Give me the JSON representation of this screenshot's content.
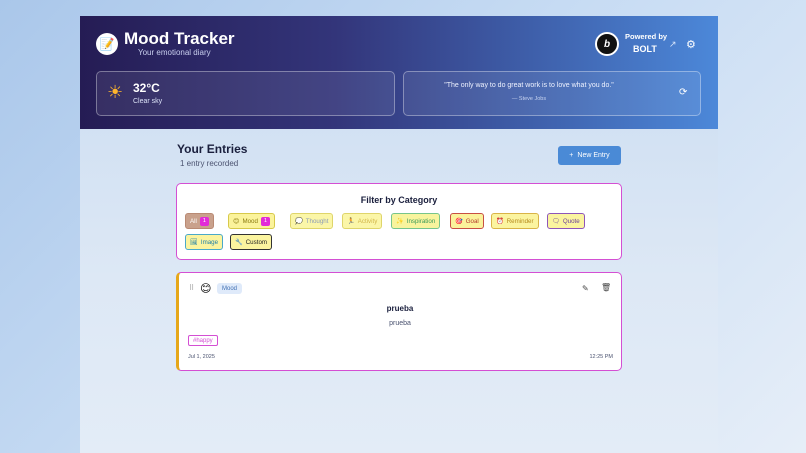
{
  "header": {
    "logo_icon": "📝",
    "title": "Mood Tracker",
    "subtitle": "Your emotional diary",
    "bolt_badge": "b",
    "powered_by": "Powered by",
    "bolt_name": "BOLT",
    "external_link_icon": "↗",
    "settings_icon": "⚙"
  },
  "weather": {
    "icon": "☀",
    "temperature": "32°C",
    "description": "Clear sky"
  },
  "quote": {
    "text": "\"The only way to do great work is to love what you do.\"",
    "author": "— Steve Jobs",
    "refresh_icon": "⟳"
  },
  "entries": {
    "title": "Your Entries",
    "count_label": "1 entry recorded",
    "new_entry_plus": "+",
    "new_entry_label": "New Entry"
  },
  "filter": {
    "title": "Filter by Category",
    "chips": [
      {
        "icon": "",
        "label": "All",
        "count": "1"
      },
      {
        "icon": "😊",
        "label": "Mood",
        "count": "1"
      },
      {
        "icon": "💭",
        "label": "Thought",
        "count": ""
      },
      {
        "icon": "🏃",
        "label": "Activity",
        "count": ""
      },
      {
        "icon": "✨",
        "label": "Inspiration",
        "count": ""
      },
      {
        "icon": "🎯",
        "label": "Goal",
        "count": ""
      },
      {
        "icon": "⏰",
        "label": "Reminder",
        "count": ""
      },
      {
        "icon": "🗨",
        "label": "Quote",
        "count": ""
      },
      {
        "icon": "🖼",
        "label": "Image",
        "count": ""
      },
      {
        "icon": "🔧",
        "label": "Custom",
        "count": ""
      }
    ]
  },
  "entry": {
    "drag_icon": "⠿",
    "emoji": "😊",
    "category": "Mood",
    "edit_icon": "✎",
    "delete_icon": "🗑",
    "title": "prueba",
    "body": "prueba",
    "tag": "#happy",
    "date": "Jul 1, 2025",
    "time": "12:25 PM"
  },
  "colors": {
    "accent": "#4a8ad6",
    "card_border": "#d44fd3",
    "count_badge": "#e22bd8",
    "entry_left_border": "#e6a719"
  }
}
